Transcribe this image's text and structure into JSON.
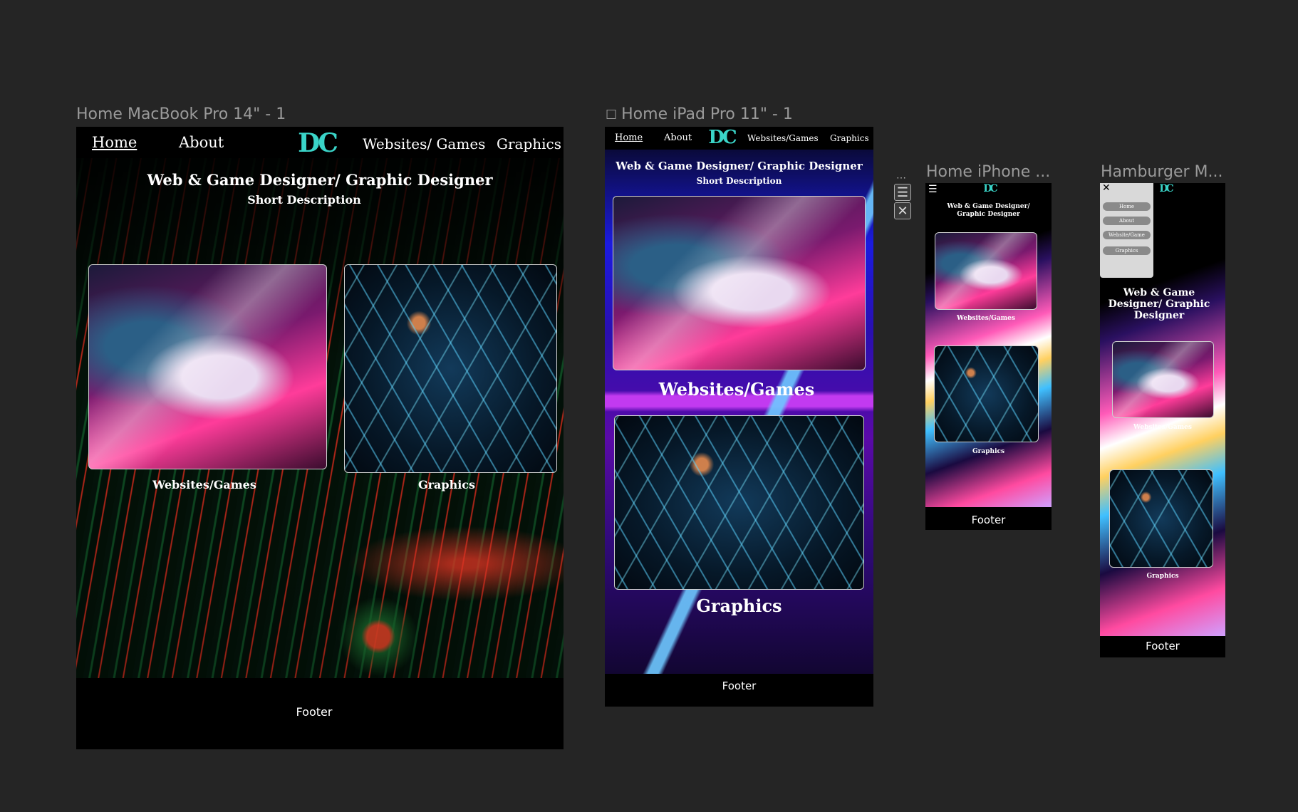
{
  "frames": {
    "macbook": {
      "label": "Home MacBook Pro 14\" - 1",
      "nav": {
        "home": "Home",
        "about": "About",
        "logo": "DC",
        "websites": "Websites/ Games",
        "graphics": "Graphics"
      },
      "heading": "Web & Game Designer/ Graphic Designer",
      "subheading": "Short Description",
      "card1_caption": "Websites/Games",
      "card2_caption": "Graphics",
      "footer": "Footer"
    },
    "ipad": {
      "label": "Home iPad Pro 11\" - 1",
      "nav": {
        "home": "Home",
        "about": "About",
        "logo": "DC",
        "websites": "Websites/Games",
        "graphics": "Graphics"
      },
      "heading": "Web & Game Designer/ Graphic Designer",
      "subheading": "Short Description",
      "card1_caption": "Websites/Games",
      "card2_caption": "Graphics",
      "footer": "Footer"
    },
    "iphone": {
      "label": "Home iPhone ...",
      "logo": "DC",
      "heading_line1": "Web & Game Designer/",
      "heading_line2": "Graphic Designer",
      "card1_caption": "Websites/Games",
      "card2_caption": "Graphics",
      "footer": "Footer"
    },
    "hamburger": {
      "label": "Hamburger M...",
      "logo": "DC",
      "menu_items": [
        "Home",
        "About",
        "Website/Game",
        "Graphics"
      ],
      "heading_line1": "Web & Game",
      "heading_line2": "Designer/ Graphic",
      "heading_line3": "Designer",
      "card1_caption": "Websites/Games",
      "card2_caption": "Graphics",
      "footer": "Footer"
    }
  },
  "icons": {
    "frame_icon": "☐",
    "menu_icon": "☰",
    "close_icon": "✕",
    "more_icon": "⋯"
  }
}
